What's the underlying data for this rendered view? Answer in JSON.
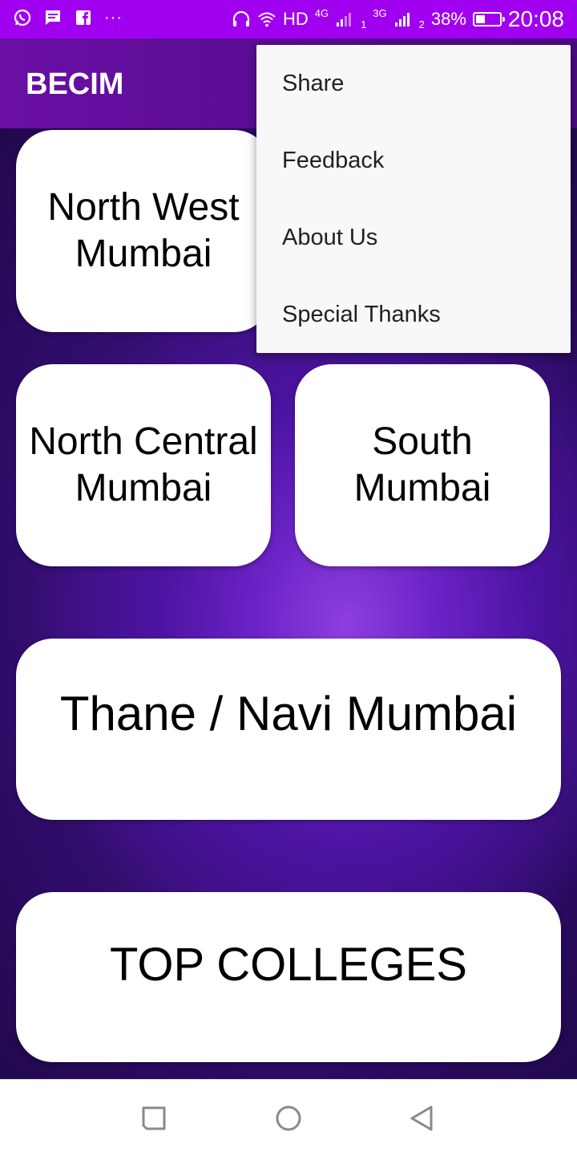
{
  "status_bar": {
    "icons_left": [
      "whatsapp-icon",
      "message-icon",
      "facebook-icon",
      "more-notifications-icon"
    ],
    "more": "···",
    "hd": "HD",
    "net1": "4G",
    "sim1": "1",
    "net2": "3G",
    "sim2": "2",
    "battery_percent": "38%",
    "battery_level": 0.38,
    "time": "20:08"
  },
  "app_bar": {
    "title": "BECIM"
  },
  "menu": {
    "items": [
      {
        "label": "Share"
      },
      {
        "label": "Feedback"
      },
      {
        "label": "About Us"
      },
      {
        "label": "Special Thanks"
      }
    ]
  },
  "cards": {
    "north_west": {
      "line1": "North West",
      "line2": "Mumbai"
    },
    "north_central": {
      "line1": "North Central",
      "line2": "Mumbai"
    },
    "south": {
      "line1": "South",
      "line2": "Mumbai"
    },
    "thane": {
      "label": "Thane / Navi Mumbai"
    },
    "top_colleges": {
      "label": "TOP COLLEGES"
    }
  },
  "nav_bar": {
    "icons": [
      "recent-apps-icon",
      "home-icon",
      "back-icon"
    ]
  },
  "colors": {
    "status_bar": "#a100f0",
    "app_bar": "#6a0fa5",
    "background": "#4b13a0",
    "card": "#ffffff",
    "menu": "#f8f8f8"
  }
}
